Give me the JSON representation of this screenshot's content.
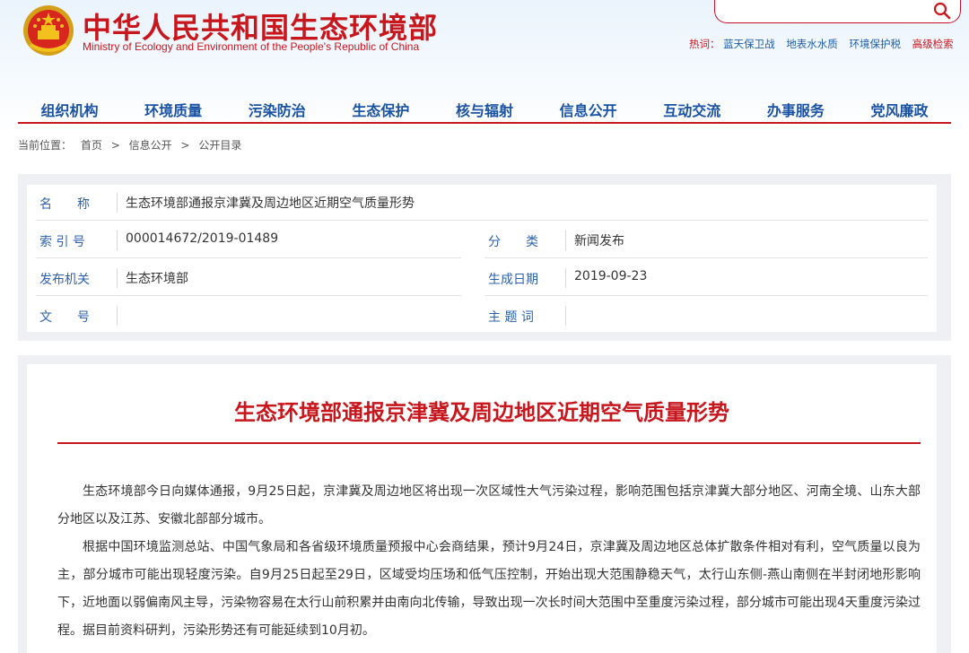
{
  "site": {
    "title_cn": "中华人民共和国生态环境部",
    "title_en": "Ministry of Ecology and Environment of the People's Republic of China"
  },
  "search": {
    "placeholder": "",
    "hotwords_label": "热词：",
    "hotwords": [
      "蓝天保卫战",
      "地表水水质",
      "环境保护税"
    ],
    "advanced": "高级检索"
  },
  "nav": [
    "组织机构",
    "环境质量",
    "污染防治",
    "生态保护",
    "核与辐射",
    "信息公开",
    "互动交流",
    "办事服务",
    "党风廉政"
  ],
  "breadcrumb": {
    "label": "当前位置：",
    "items": [
      "首页",
      ">",
      "信息公开",
      ">",
      "公开目录"
    ]
  },
  "meta": {
    "name_key": "名　　称",
    "name_value": "生态环境部通报京津冀及周边地区近期空气质量形势",
    "index_key": "索 引 号",
    "index_value": "000014672/2019-01489",
    "category_key": "分　　类",
    "category_value": "新闻发布",
    "issuer_key": "发布机关",
    "issuer_value": "生态环境部",
    "date_key": "生成日期",
    "date_value": "2019-09-23",
    "docno_key": "文　　号",
    "docno_value": "",
    "subject_key": "主 题 词",
    "subject_value": ""
  },
  "article": {
    "title": "生态环境部通报京津冀及周边地区近期空气质量形势",
    "paragraphs": [
      "生态环境部今日向媒体通报，9月25日起，京津冀及周边地区将出现一次区域性大气污染过程，影响范围包括京津冀大部分地区、河南全境、山东大部分地区以及江苏、安徽北部部分城市。",
      "根据中国环境监测总站、中国气象局和各省级环境质量预报中心会商结果，预计9月24日，京津冀及周边地区总体扩散条件相对有利，空气质量以良为主，部分城市可能出现轻度污染。自9月25日起至29日，区域受均压场和低气压控制，开始出现大范围静稳天气，太行山东侧-燕山南侧在半封闭地形影响下，近地面以弱偏南风主导，污染物容易在太行山前积累并由南向北传输，导致出现一次长时间大范围中至重度污染过程，部分城市可能出现4天重度污染过程。据目前资料研判，污染形势还有可能延续到10月初。"
    ]
  },
  "colors": {
    "brand_red": "#c8161d",
    "nav_blue": "#1a52a3",
    "key_blue": "#2d62ac"
  }
}
